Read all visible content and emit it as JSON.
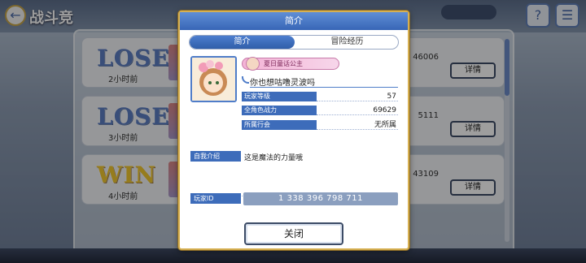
{
  "background": {
    "screen_title": "战斗竞",
    "records": [
      {
        "result": "LOSE",
        "time_ago": "2小时前",
        "score": "46006",
        "detail_label": "详情"
      },
      {
        "result": "LOSE",
        "time_ago": "3小时前",
        "score": "5111",
        "detail_label": "详情"
      },
      {
        "result": "WIN",
        "time_ago": "4小时前",
        "score": "43109",
        "detail_label": "详情"
      }
    ]
  },
  "modal": {
    "title": "简介",
    "tabs": [
      "简介",
      "冒险经历"
    ],
    "profile": {
      "badge_title": "夏日童话公主",
      "name": "你也想咕噜灵波吗"
    },
    "stats": [
      {
        "label": "玩家等级",
        "value": "57"
      },
      {
        "label": "全角色战力",
        "value": "69629"
      },
      {
        "label": "所属行会",
        "value": "无所属"
      }
    ],
    "intro": {
      "label": "自我介绍",
      "text": "这是魔法的力量哦"
    },
    "player_id": {
      "label": "玩家ID",
      "value": "1 338 396 798 711"
    },
    "close_label": "关闭"
  },
  "colors": {
    "accent": "#3d6cba",
    "frame_gold": "#d6b052",
    "lose": "#5d7fc3",
    "win": "#f3c930"
  }
}
